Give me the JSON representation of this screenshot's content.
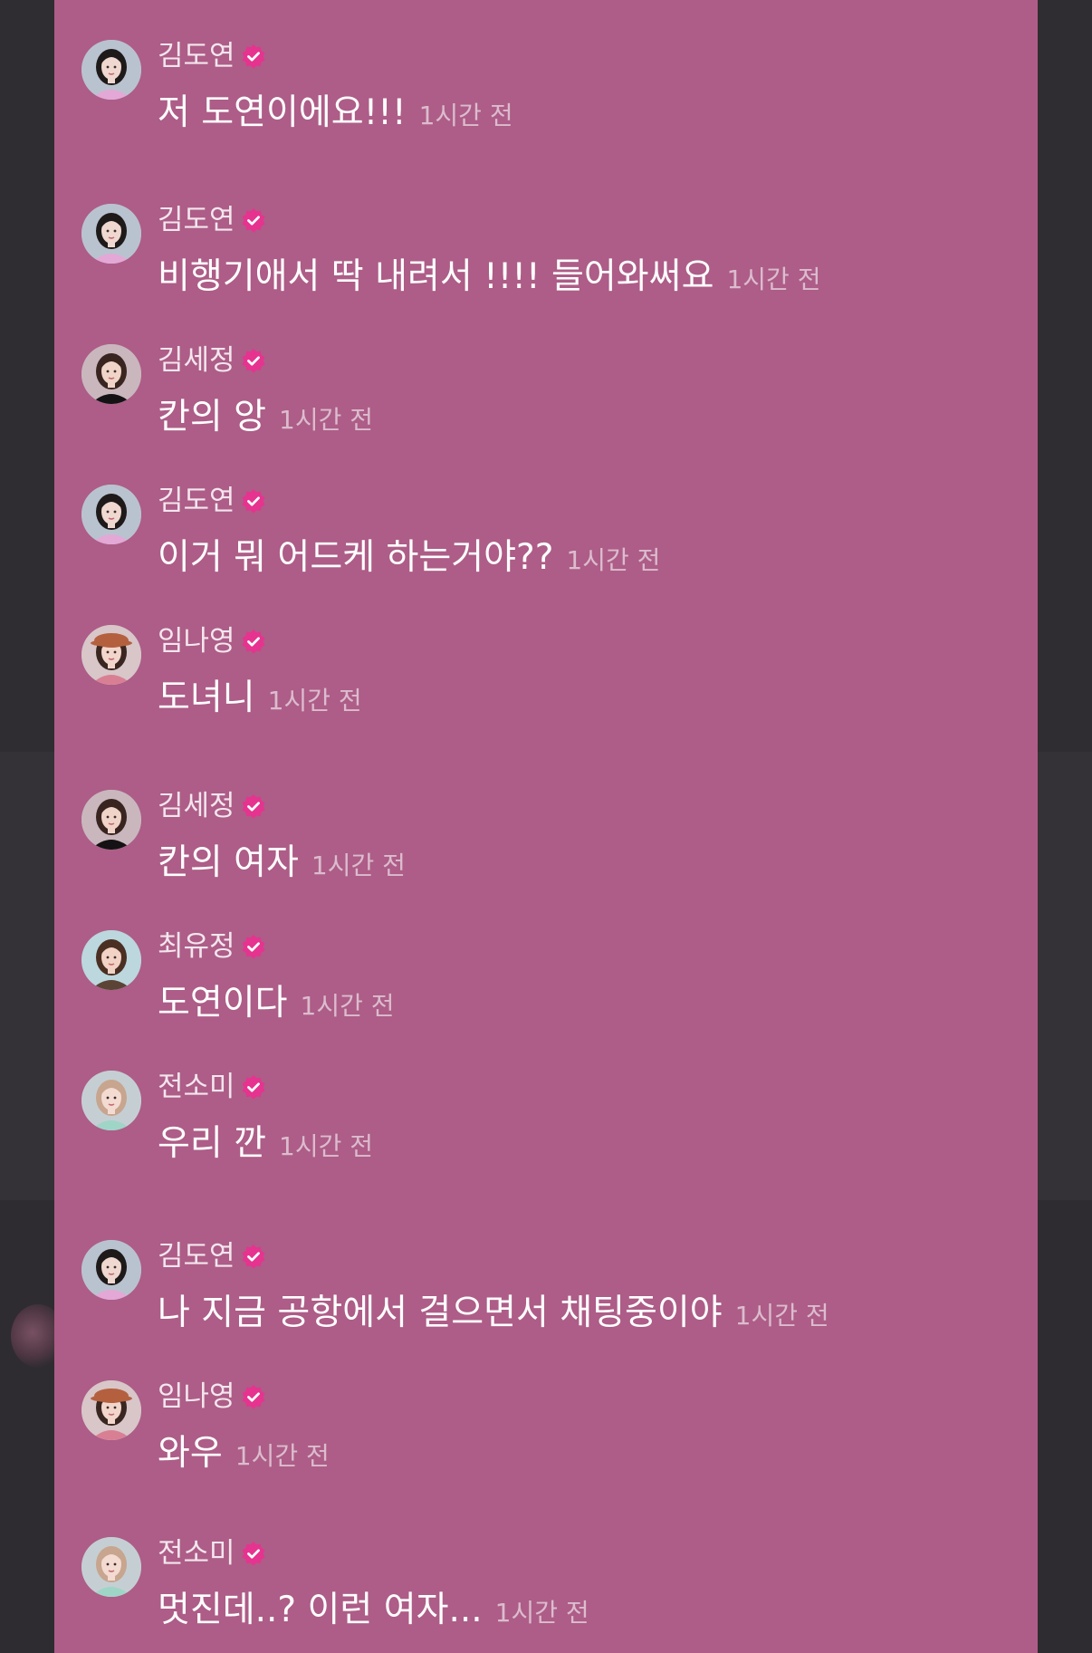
{
  "colors": {
    "panel": "#ad5d87",
    "background": "#2c2a2e",
    "verified_badge": "#e6338f",
    "name_text": "#f3e6ee",
    "message_text": "#ffffff",
    "time_text": "#dcbcce"
  },
  "messages": [
    {
      "name": "김도연",
      "verified": true,
      "avatar_icon": "avatar-kimdoyeon",
      "text": "저 도연이에요!!!",
      "time": "1시간 전"
    },
    {
      "name": "김도연",
      "verified": true,
      "avatar_icon": "avatar-kimdoyeon",
      "text": "비행기애서 딱 내려서 !!!! 들어와써요",
      "time": "1시간 전"
    },
    {
      "name": "김세정",
      "verified": true,
      "avatar_icon": "avatar-kimsejeong",
      "text": "칸의 앙",
      "time": "1시간 전"
    },
    {
      "name": "김도연",
      "verified": true,
      "avatar_icon": "avatar-kimdoyeon",
      "text": "이거 뭐 어드케 하는거야??",
      "time": "1시간 전"
    },
    {
      "name": "임나영",
      "verified": true,
      "avatar_icon": "avatar-imnayoung",
      "text": "도녀니",
      "time": "1시간 전"
    },
    {
      "name": "김세정",
      "verified": true,
      "avatar_icon": "avatar-kimsejeong",
      "text": "칸의 여자",
      "time": "1시간 전"
    },
    {
      "name": "최유정",
      "verified": true,
      "avatar_icon": "avatar-choiyoojung",
      "text": "도연이다",
      "time": "1시간 전"
    },
    {
      "name": "전소미",
      "verified": true,
      "avatar_icon": "avatar-jeonsomi",
      "text": "우리 깐",
      "time": "1시간 전"
    },
    {
      "name": "김도연",
      "verified": true,
      "avatar_icon": "avatar-kimdoyeon",
      "text": "나 지금 공항에서 걸으면서 채팅중이야",
      "time": "1시간 전"
    },
    {
      "name": "임나영",
      "verified": true,
      "avatar_icon": "avatar-imnayoung",
      "text": "와우",
      "time": "1시간 전"
    },
    {
      "name": "전소미",
      "verified": true,
      "avatar_icon": "avatar-jeonsomi",
      "text": "멋진데..? 이런 여자...",
      "time": "1시간 전"
    }
  ]
}
